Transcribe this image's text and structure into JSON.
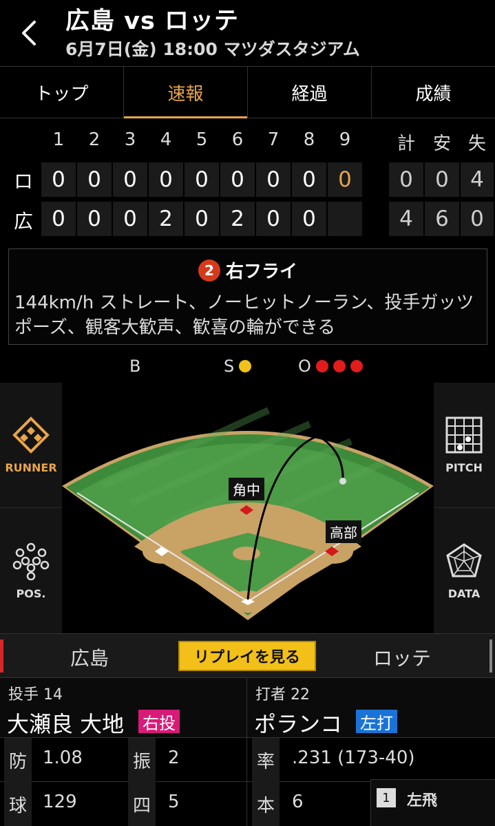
{
  "header": {
    "title": "広島 vs ロッテ",
    "subtitle": "6月7日(金) 18:00 マツダスタジアム"
  },
  "tabs": [
    {
      "label": "トップ"
    },
    {
      "label": "速報"
    },
    {
      "label": "経過"
    },
    {
      "label": "成績"
    }
  ],
  "active_tab": "速報",
  "scoreboard": {
    "innings": [
      "1",
      "2",
      "3",
      "4",
      "5",
      "6",
      "7",
      "8",
      "9"
    ],
    "total_headers": [
      "計",
      "安",
      "失"
    ],
    "rows": [
      {
        "team": "ロ",
        "scores": [
          "0",
          "0",
          "0",
          "0",
          "0",
          "0",
          "0",
          "0",
          "0"
        ],
        "totals": [
          "0",
          "0",
          "4"
        ]
      },
      {
        "team": "広",
        "scores": [
          "0",
          "0",
          "0",
          "2",
          "0",
          "2",
          "0",
          "0",
          ""
        ],
        "totals": [
          "4",
          "6",
          "0"
        ]
      }
    ]
  },
  "play": {
    "outs_number": "2",
    "result": "右フライ",
    "description": "144km/h ストレート、ノーヒットノーラン、投手ガッツポーズ、観客大歓声、歓喜の輪ができる"
  },
  "count": {
    "balls_label": "B",
    "balls": 0,
    "strikes_label": "S",
    "strikes": 1,
    "outs_label": "O",
    "outs": 3
  },
  "side_buttons": {
    "runner": "RUNNER",
    "pos": "POS.",
    "pitch": "PITCH",
    "data": "DATA"
  },
  "field": {
    "fielder_center": "角中",
    "fielder_second": "高部"
  },
  "teambar": {
    "home": "広島",
    "replay": "リプレイを見る",
    "away": "ロッテ"
  },
  "pitcher": {
    "role": "投手 14",
    "name": "大瀬良 大地",
    "tag": "右投"
  },
  "batter": {
    "role": "打者 22",
    "name": "ポランコ",
    "tag": "左打"
  },
  "pitcher_stats": [
    {
      "k": "防",
      "v": "1.08"
    },
    {
      "k": "振",
      "v": "2"
    },
    {
      "k": "球",
      "v": "129"
    },
    {
      "k": "四",
      "v": "5"
    }
  ],
  "batter_stats": [
    {
      "k": "率",
      "v": ".231 (173-40)"
    },
    {
      "k": "本",
      "v": "6"
    }
  ],
  "at_bat_history": [
    {
      "num": "1",
      "result": "左飛"
    }
  ],
  "colors": {
    "accent": "#e8a54a",
    "strike": "#f0c21a",
    "out": "#e21b1b",
    "pitcher_tag": "#d81b78",
    "batter_tag": "#1a73d6",
    "replay": "#f2c018"
  }
}
